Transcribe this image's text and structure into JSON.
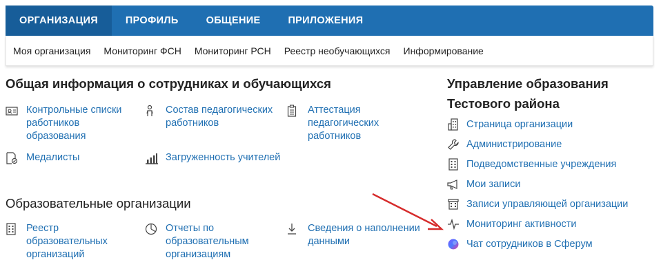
{
  "topnav": {
    "tabs": [
      {
        "label": "ОРГАНИЗАЦИЯ",
        "active": true
      },
      {
        "label": "ПРОФИЛЬ"
      },
      {
        "label": "ОБЩЕНИЕ"
      },
      {
        "label": "ПРИЛОЖЕНИЯ"
      }
    ]
  },
  "subnav": {
    "items": [
      "Моя организация",
      "Мониторинг ФСН",
      "Мониторинг РСН",
      "Реестр необучающихся",
      "Информирование"
    ]
  },
  "sections": {
    "staff": {
      "title": "Общая информация о сотрудниках и обучающихся",
      "links": [
        {
          "label": "Контрольные списки работников образования",
          "icon": "id-card-icon"
        },
        {
          "label": "Состав педагогических работников",
          "icon": "person-icon"
        },
        {
          "label": "Аттестация педагогических работников",
          "icon": "clipboard-icon"
        },
        {
          "label": "Медалисты",
          "icon": "medal-document-icon"
        },
        {
          "label": "Загруженность учителей",
          "icon": "bar-chart-icon"
        }
      ]
    },
    "orgs": {
      "title": "Образовательные организации",
      "links": [
        {
          "label": "Реестр образовательных организаций",
          "icon": "building-icon"
        },
        {
          "label": "Отчеты по образовательным организациям",
          "icon": "pie-chart-icon"
        },
        {
          "label": "Сведения о наполнении данными",
          "icon": "download-icon"
        }
      ]
    },
    "management": {
      "title_line1": "Управление образования",
      "title_line2": "Тестового района",
      "links": [
        {
          "label": "Страница организации",
          "icon": "office-icon"
        },
        {
          "label": "Администрирование",
          "icon": "wrench-icon"
        },
        {
          "label": "Подведомственные учреждения",
          "icon": "building-icon"
        },
        {
          "label": "Мои записи",
          "icon": "megaphone-icon"
        },
        {
          "label": "Записи управляющей организации",
          "icon": "bank-icon"
        },
        {
          "label": "Мониторинг активности",
          "icon": "pulse-icon"
        },
        {
          "label": "Чат сотрудников в Сферум",
          "icon": "sferum-icon"
        }
      ]
    }
  },
  "colors": {
    "nav_bg": "#1f6fb2",
    "nav_active": "#175d99",
    "link": "#1f6fb2",
    "arrow": "#d62b2b"
  }
}
